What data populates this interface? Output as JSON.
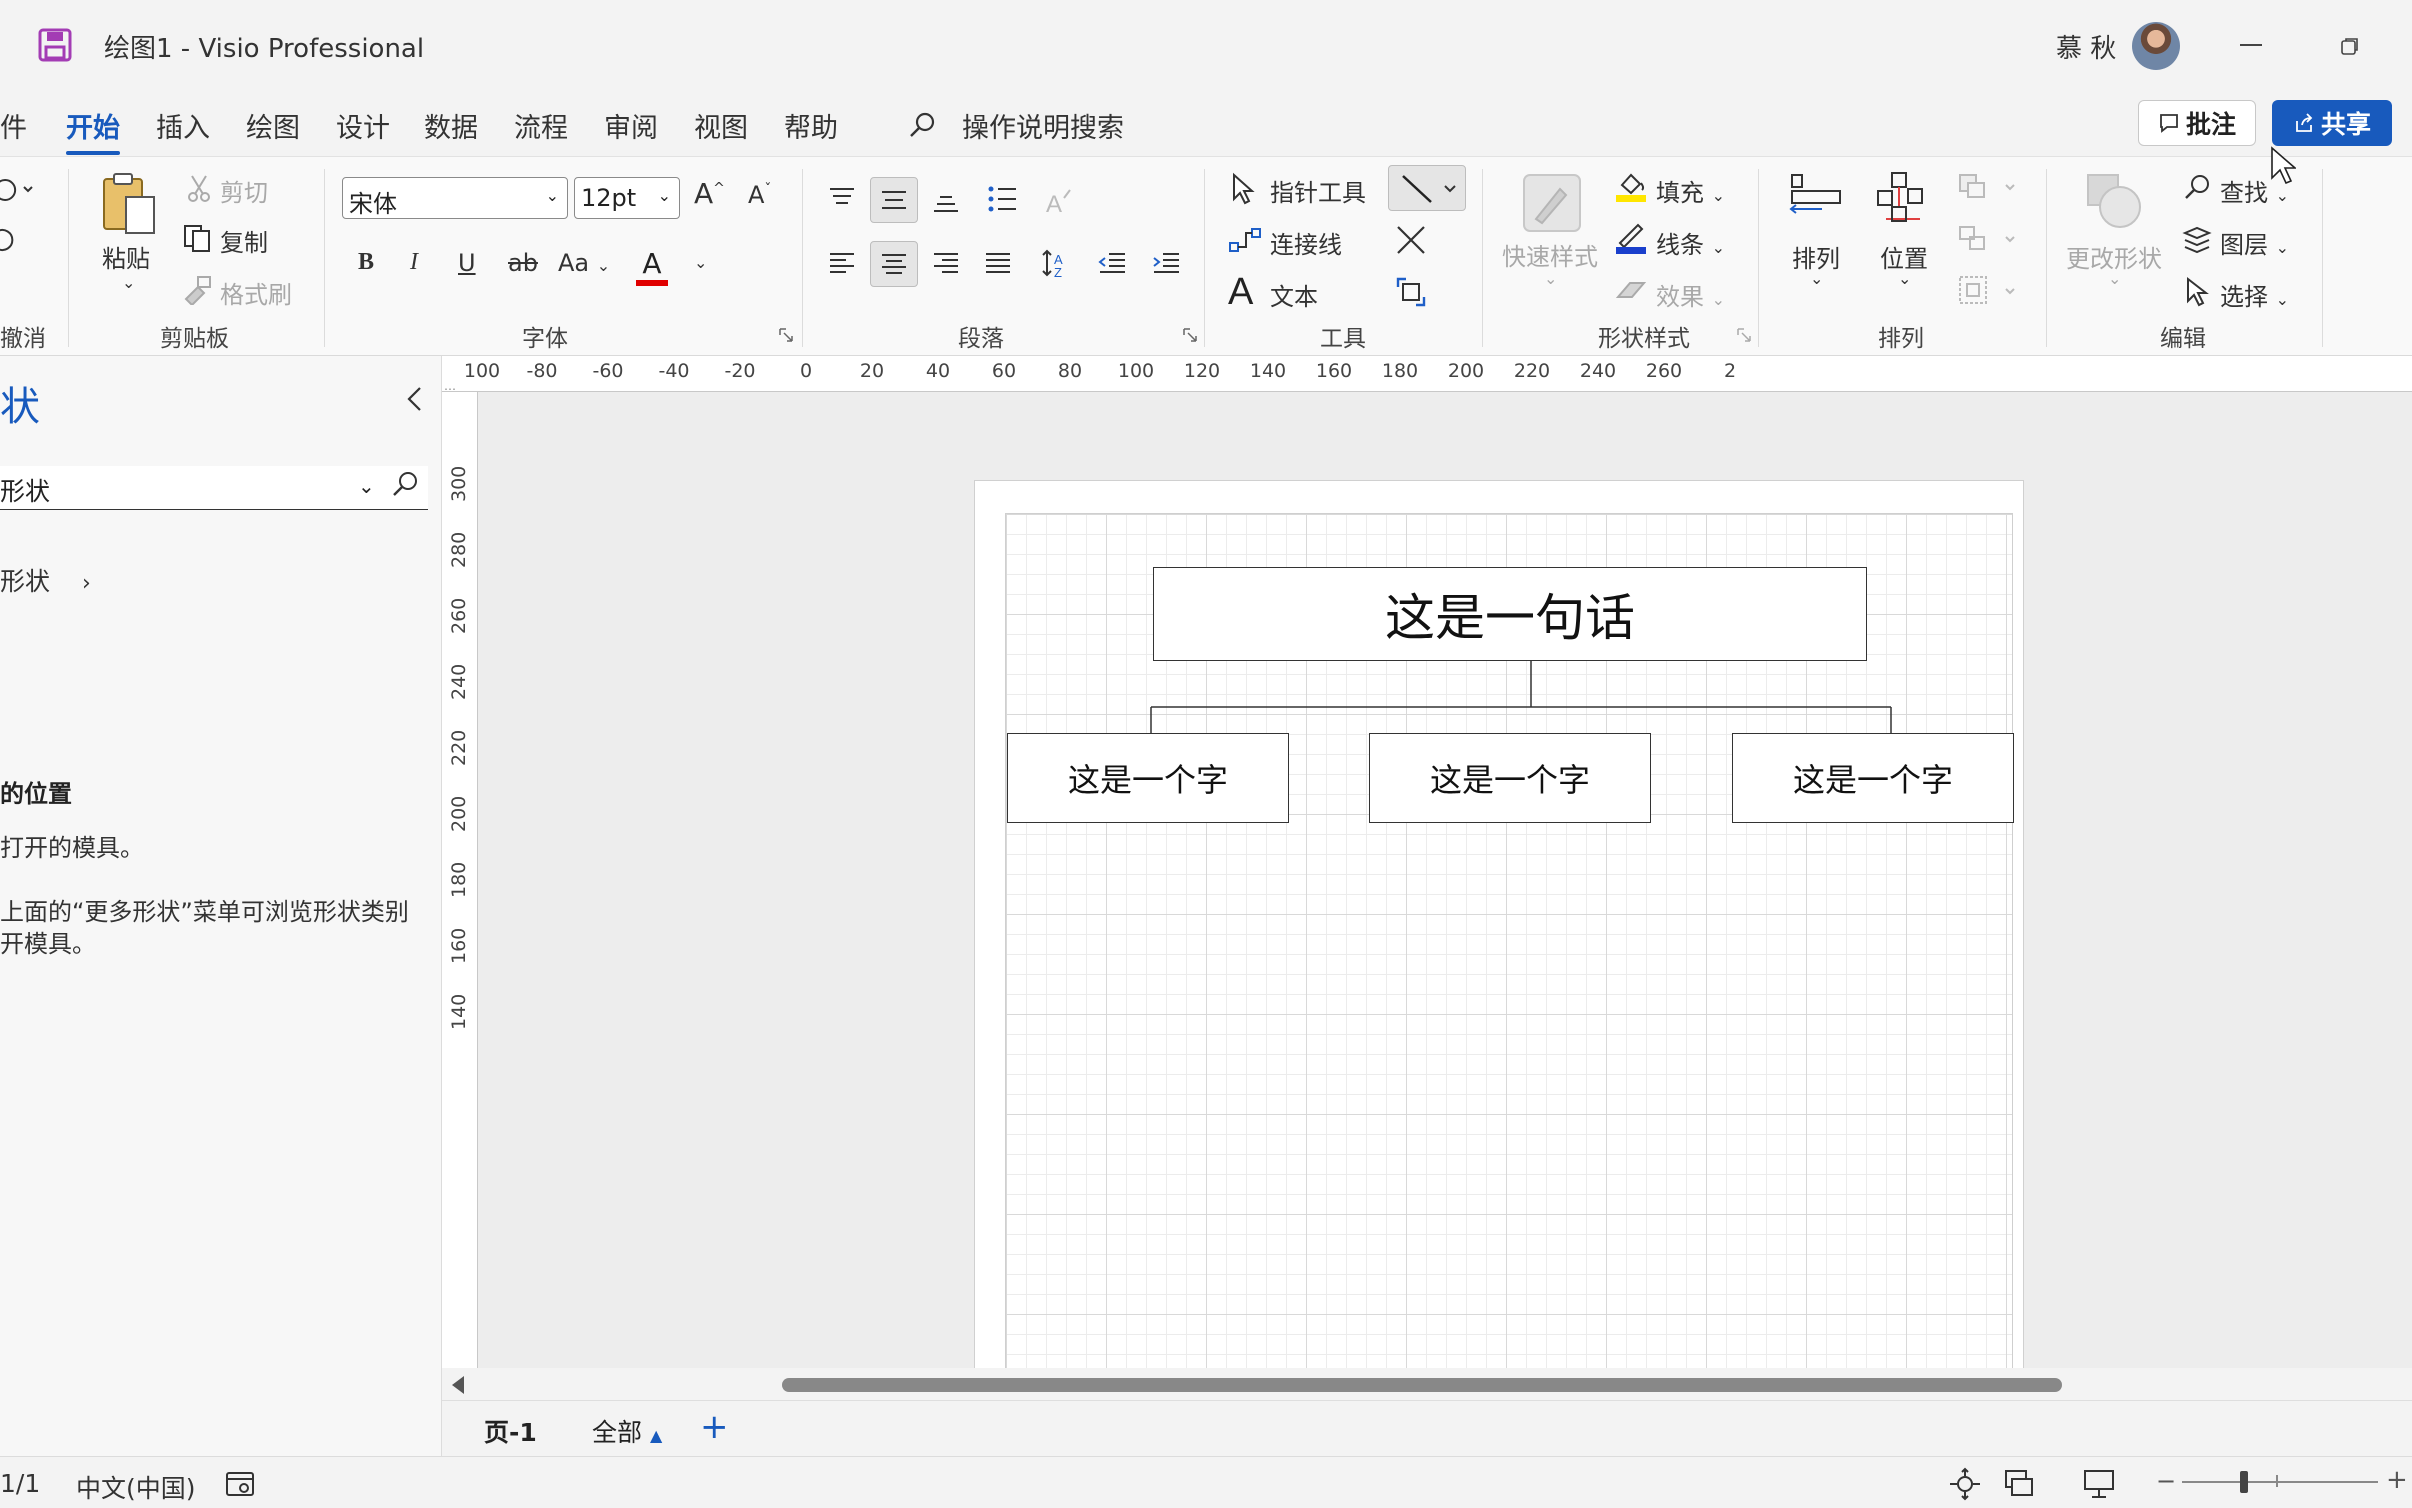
{
  "window": {
    "title": "绘图1  -  Visio Professional",
    "user_name": "慕 秋"
  },
  "menu": {
    "tabs": [
      "件",
      "开始",
      "插入",
      "绘图",
      "设计",
      "数据",
      "流程",
      "审阅",
      "视图",
      "帮助"
    ],
    "active_tab": "开始",
    "search_label": "操作说明搜索",
    "comment_button": "批注",
    "share_button": "共享"
  },
  "ribbon": {
    "undo_group": "撤消",
    "clipboard": {
      "label": "剪贴板",
      "paste": "粘贴",
      "cut": "剪切",
      "copy": "复制",
      "format_painter": "格式刷"
    },
    "font": {
      "label": "字体",
      "font_name": "宋体",
      "font_size": "12pt",
      "bold": "B",
      "italic": "I",
      "underline": "U",
      "strike": "ab",
      "change_case": "Aa",
      "font_color_letter": "A",
      "grow": "A",
      "shrink": "A"
    },
    "paragraph": {
      "label": "段落"
    },
    "tools": {
      "label": "工具",
      "pointer": "指针工具",
      "connector": "连接线",
      "text": "文本",
      "text_glyph": "A"
    },
    "shape_styles": {
      "label": "形状样式",
      "quick_styles": "快速样式",
      "fill": "填充",
      "line": "线条",
      "effects": "效果"
    },
    "arrange": {
      "label": "排列",
      "arrange": "排列",
      "position": "位置"
    },
    "editing": {
      "label": "编辑",
      "change_shape": "更改形状",
      "find": "查找",
      "layers": "图层",
      "select": "选择"
    }
  },
  "shapes_pane": {
    "heading": "状",
    "search_value": "形状",
    "more_shapes": "形状",
    "info_heading": "的位置",
    "info_line1": "打开的模具。",
    "info_line2": "上面的“更多形状”菜单可浏览形状类别",
    "info_line3": "开模具。"
  },
  "ruler": {
    "horizontal": [
      "100",
      "-80",
      "-60",
      "-40",
      "-20",
      "0",
      "20",
      "40",
      "60",
      "80",
      "100",
      "120",
      "140",
      "160",
      "180",
      "200",
      "220",
      "240",
      "260",
      "2"
    ],
    "vertical": [
      "300",
      "280",
      "260",
      "240",
      "220",
      "200",
      "180",
      "160",
      "140"
    ]
  },
  "diagram": {
    "top_box": "这是一句话",
    "child_boxes": [
      "这是一个字",
      "这是一个字",
      "这是一个字"
    ]
  },
  "page_tabs": {
    "current": "页-1",
    "all": "全部"
  },
  "status": {
    "page": "1/1",
    "language": "中文(中国)"
  },
  "colors": {
    "accent": "#185abd",
    "font_color_bar": "#e00000",
    "fill_color_bar": "#ffe600",
    "line_color_bar": "#1a3fcc",
    "app_icon": "#a33cb4"
  }
}
